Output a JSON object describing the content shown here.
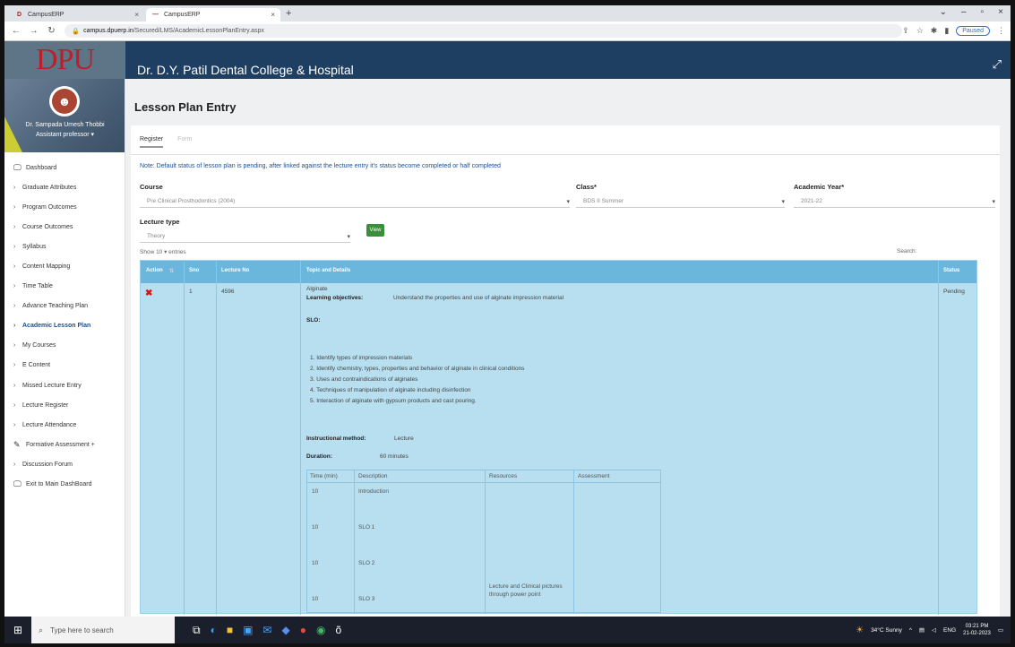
{
  "browser": {
    "tabs": [
      {
        "icon": "D",
        "label": "CampusERP"
      },
      {
        "icon": "—",
        "label": "CampusERP"
      }
    ],
    "new_tab": "+",
    "url_domain": "campus.dpuerp.in",
    "url_path": "/Secured/LMS/AcademicLessonPlanEntry.aspx",
    "profile_status": "Paused"
  },
  "app": {
    "logo_text": "DPU",
    "title": "Dr. D.Y. Patil Dental College & Hospital"
  },
  "profile": {
    "name": "Dr. Sampada Umesh Thobbi",
    "role": "Assistant professor ▾"
  },
  "sidebar": {
    "items": [
      {
        "label": "Dashboard",
        "icon": "monitor-icon"
      },
      {
        "label": "Graduate Attributes"
      },
      {
        "label": "Program Outcomes"
      },
      {
        "label": "Course Outcomes"
      },
      {
        "label": "Syllabus"
      },
      {
        "label": "Content Mapping"
      },
      {
        "label": "Time Table"
      },
      {
        "label": "Advance Teaching Plan"
      },
      {
        "label": "Academic Lesson Plan",
        "active": true
      },
      {
        "label": "My Courses"
      },
      {
        "label": "E Content"
      },
      {
        "label": "Missed Lecture Entry"
      },
      {
        "label": "Lecture Register"
      },
      {
        "label": "Lecture Attendance"
      },
      {
        "label": "Formative Assessment  +",
        "icon": "clipboard-icon"
      },
      {
        "label": "Discussion Forum"
      },
      {
        "label": "Exit to Main DashBoard",
        "icon": "monitor-icon"
      }
    ]
  },
  "page": {
    "title": "Lesson Plan Entry",
    "tabs": {
      "register": "Register",
      "form": "Form"
    },
    "note": "Note: Default status of lesson plan is pending, after linked against the lecture entry it's status become completed or half completed"
  },
  "form": {
    "course_label": "Course",
    "course_value": "Pre Clinical Prosthodontics (2004)",
    "class_label": "Class*",
    "class_value": "BDS II Summer",
    "year_label": "Academic Year*",
    "year_value": "2021-22",
    "lecture_type_label": "Lecture type",
    "lecture_type_value": "Theory",
    "view_button": "View"
  },
  "list": {
    "show_text": "Show  10    ▾  entries",
    "search_label": "Search:"
  },
  "table": {
    "headers": {
      "action": "Action",
      "srno": "Sno",
      "lecture_no": "Lecture No",
      "topic": "Topic and Details",
      "status": "Status"
    },
    "row": {
      "srno": "1",
      "lecture_no": "4596",
      "topic": "Alginate",
      "lo_label": "Learning objectives:",
      "lo_value": "Understand the properties and use of alginate impression material",
      "slo_label": "SLO:",
      "slo_items": [
        "1. Identify types of impression materials",
        "2. Identify chemistry, types, properties and behavior of alginate in clinical conditions",
        "3. Uses and contraindications of alginates",
        "4. Techniques of manipulation of alginate including disinfection",
        "5. Interaction of alginate with gypsum products and cast pouring."
      ],
      "instructional_label": "Instructional method:",
      "instructional_value": "Lecture",
      "duration_label": "Duration:",
      "duration_value": "60 minutes",
      "status": "Pending"
    },
    "inner": {
      "headers": [
        "Time (min)",
        "Description",
        "Resources",
        "Assessment"
      ],
      "rows": [
        {
          "time": "10",
          "desc": "Introduction"
        },
        {
          "time": "10",
          "desc": "SLO 1"
        },
        {
          "time": "10",
          "desc": "SLO 2"
        },
        {
          "time": "10",
          "desc": "SLO 3"
        }
      ],
      "resources": "Lecture and Clinical pictures through power point"
    }
  },
  "taskbar": {
    "search_placeholder": "Type here to search",
    "weather": "34°C  Sunny",
    "lang": "ENG",
    "time": "03:21 PM",
    "date": "21-02-2023"
  }
}
